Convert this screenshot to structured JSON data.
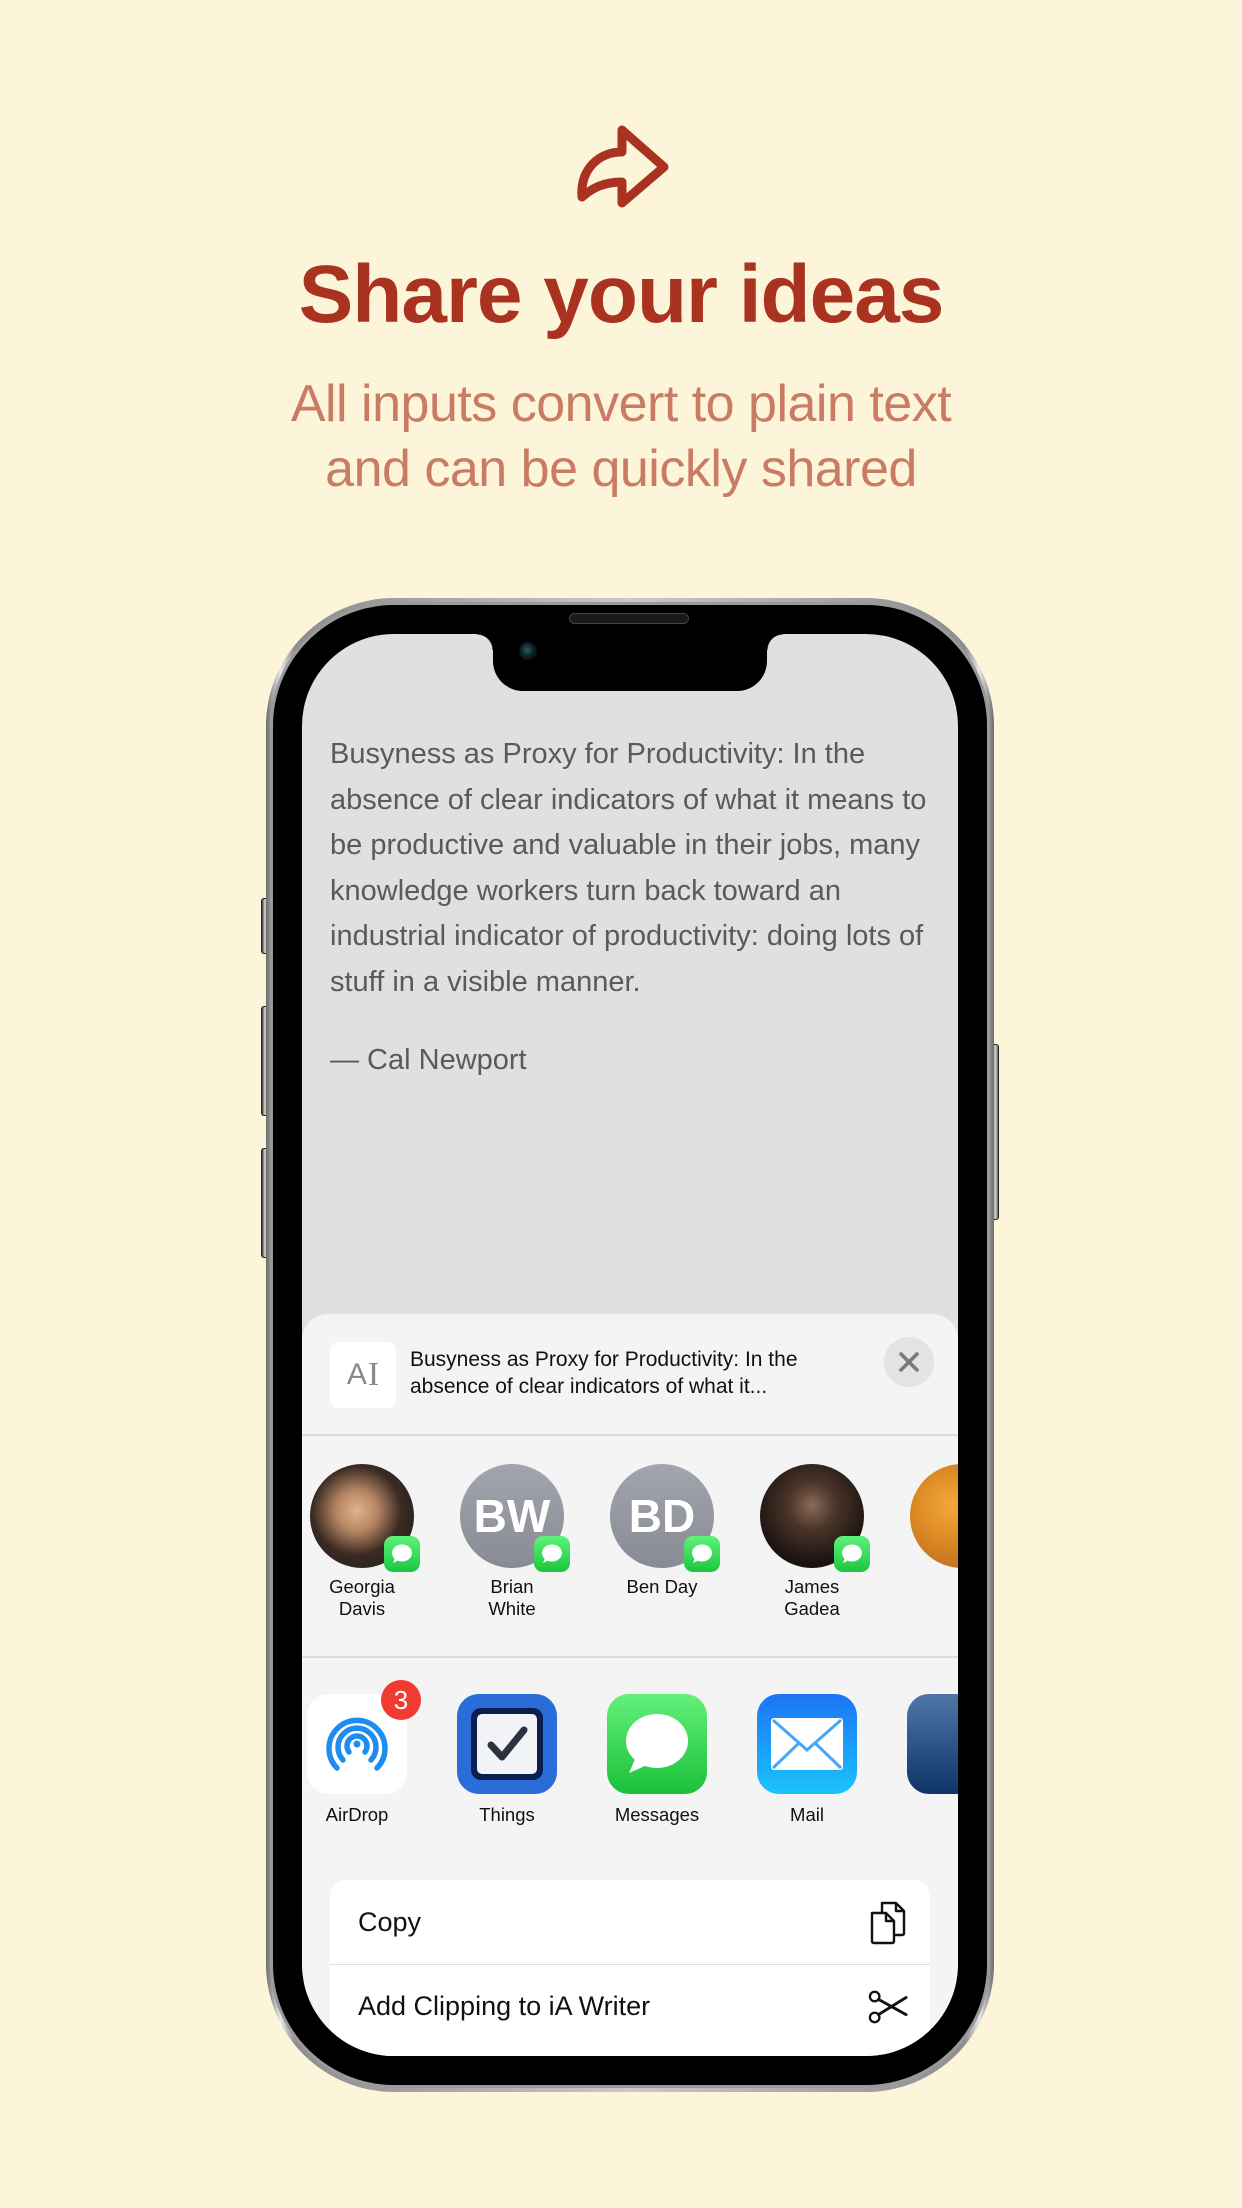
{
  "hero": {
    "icon": "share-arrow-icon",
    "title": "Share your ideas",
    "subtitle_lines": [
      "All inputs convert to plain text",
      "and can be quickly shared"
    ],
    "colors": {
      "background": "#FDF5D9",
      "title": "#A93320",
      "subtitle": "#C97B63"
    }
  },
  "document": {
    "body": "Busyness as Proxy for Productivity: In the absence of clear indicators of what it means to be productive and valuable in their jobs, many knowledge workers turn back toward an industrial indicator of productivity: doing lots of stuff in a visible manner.",
    "attribution": "— Cal Newport"
  },
  "share_sheet": {
    "preview": {
      "thumbnail_icon": "text-document-icon",
      "thumbnail_letter": "A",
      "thumbnail_cursor": "I",
      "text_line1": "Busyness as Proxy for Productivity: In the",
      "text_line2": "absence of clear indicators of what it...",
      "close_icon": "close-icon"
    },
    "people": [
      {
        "name_line1": "Georgia",
        "name_line2": "Davis",
        "initials": "",
        "avatar": "photo",
        "badge": "messages-badge-icon"
      },
      {
        "name_line1": "Brian",
        "name_line2": "White",
        "initials": "BW",
        "avatar": "initials",
        "badge": "messages-badge-icon"
      },
      {
        "name_line1": "Ben Day",
        "name_line2": "",
        "initials": "BD",
        "avatar": "initials",
        "badge": "messages-badge-icon"
      },
      {
        "name_line1": "James",
        "name_line2": "Gadea",
        "initials": "",
        "avatar": "photo",
        "badge": "messages-badge-icon"
      },
      {
        "name_line1": "",
        "name_line2": "",
        "initials": "",
        "avatar": "photo",
        "badge": ""
      }
    ],
    "apps": [
      {
        "label": "AirDrop",
        "icon": "airdrop-icon",
        "badge": "3"
      },
      {
        "label": "Things",
        "icon": "things-icon",
        "badge": ""
      },
      {
        "label": "Messages",
        "icon": "messages-icon",
        "badge": ""
      },
      {
        "label": "Mail",
        "icon": "mail-icon",
        "badge": ""
      },
      {
        "label": "",
        "icon": "app-icon-partial",
        "badge": ""
      }
    ],
    "actions": [
      {
        "label": "Copy",
        "icon": "copy-icon"
      },
      {
        "label": "Add Clipping to iA Writer",
        "icon": "scissors-icon"
      }
    ]
  }
}
